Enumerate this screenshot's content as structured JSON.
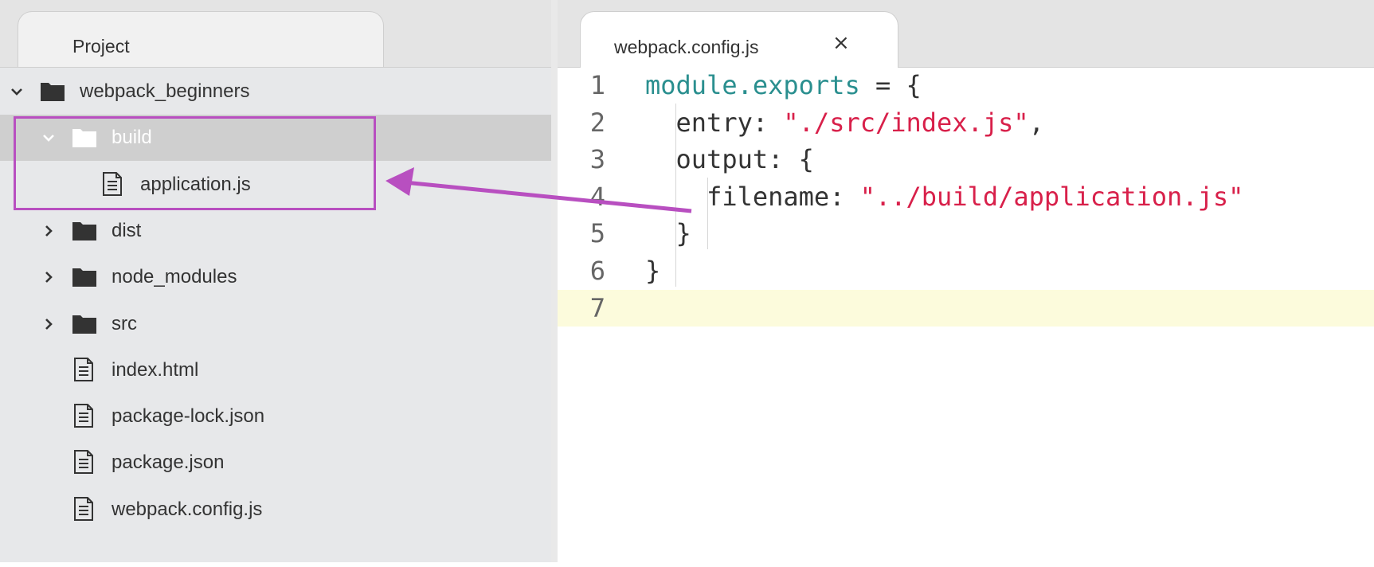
{
  "project_panel": {
    "tab_label": "Project",
    "tree": [
      {
        "label": "webpack_beginners",
        "type": "folder",
        "expanded": true,
        "depth": 0,
        "icon": "folder-icon"
      },
      {
        "label": "build",
        "type": "folder",
        "expanded": true,
        "depth": 1,
        "selected": true,
        "icon": "folder-open-icon"
      },
      {
        "label": "application.js",
        "type": "file",
        "depth": 2,
        "icon": "file-icon"
      },
      {
        "label": "dist",
        "type": "folder",
        "expanded": false,
        "depth": 1,
        "icon": "folder-icon"
      },
      {
        "label": "node_modules",
        "type": "folder",
        "expanded": false,
        "depth": 1,
        "icon": "folder-icon"
      },
      {
        "label": "src",
        "type": "folder",
        "expanded": false,
        "depth": 1,
        "icon": "folder-icon"
      },
      {
        "label": "index.html",
        "type": "file",
        "depth": 1,
        "icon": "file-icon"
      },
      {
        "label": "package-lock.json",
        "type": "file",
        "depth": 1,
        "icon": "file-icon"
      },
      {
        "label": "package.json",
        "type": "file",
        "depth": 1,
        "icon": "file-icon"
      },
      {
        "label": "webpack.config.js",
        "type": "file",
        "depth": 1,
        "icon": "file-icon"
      }
    ]
  },
  "editor": {
    "tab_label": "webpack.config.js",
    "close_icon": "×",
    "lines": [
      {
        "num": "1",
        "parts": [
          {
            "t": "module.exports",
            "c": "kw"
          },
          {
            "t": " = {",
            "c": ""
          }
        ]
      },
      {
        "num": "2",
        "parts": [
          {
            "t": "  entry: ",
            "c": ""
          },
          {
            "t": "\"./src/index.js\"",
            "c": "str"
          },
          {
            "t": ",",
            "c": ""
          }
        ]
      },
      {
        "num": "3",
        "parts": [
          {
            "t": "  output: {",
            "c": ""
          }
        ]
      },
      {
        "num": "4",
        "parts": [
          {
            "t": "    filename: ",
            "c": ""
          },
          {
            "t": "\"../build/application.js\"",
            "c": "str"
          }
        ]
      },
      {
        "num": "5",
        "parts": [
          {
            "t": "  }",
            "c": ""
          }
        ]
      },
      {
        "num": "6",
        "parts": [
          {
            "t": "}",
            "c": ""
          }
        ]
      },
      {
        "num": "7",
        "parts": [],
        "current": true
      }
    ]
  },
  "annotation": {
    "color": "#b84fc0"
  }
}
